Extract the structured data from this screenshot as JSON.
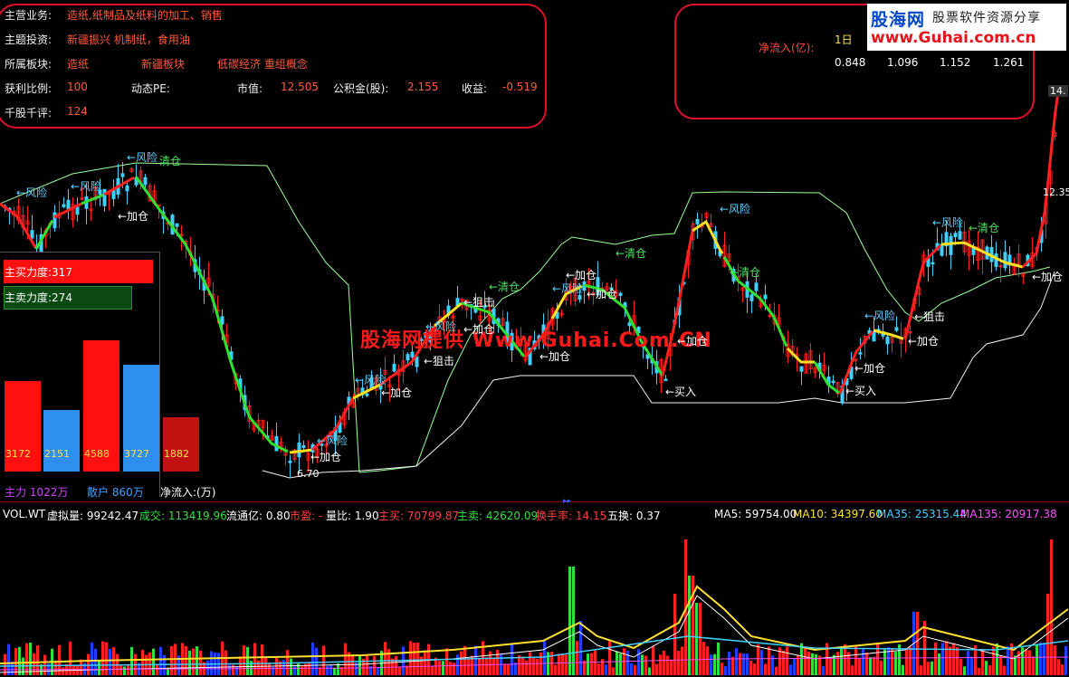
{
  "info": {
    "biz_label": "主营业务:",
    "biz_value": "造纸,纸制品及纸料的加工、销售",
    "theme_label": "主题投资:",
    "theme_value": "新疆振兴  机制纸，食用油",
    "sector_label": "所属板块:",
    "sector_1": "造纸",
    "sector_2": "新疆板块",
    "sector_3": "低碳经济 重组概念",
    "profit_label": "获利比例:",
    "profit_value": "100",
    "pe_label": "动态PE:",
    "mv_label": "市值:",
    "mv_value": "12.505",
    "fund_label": "公积金(股):",
    "fund_value": "2.155",
    "earn_label": "收益:",
    "earn_value": "-0.519",
    "review_label": "千股千评:",
    "review_value": "124"
  },
  "netflow": {
    "label": "净流入(亿):",
    "period": "1日",
    "values": [
      "0.848",
      "1.096",
      "1.152",
      "1.261"
    ]
  },
  "logo": {
    "brand": "股海网",
    "slogan": "股票软件资源分享",
    "url": "www.Guhai.com.cn"
  },
  "watermark": "股海网提供 Www.Guhai.Com.CN",
  "price_labels": {
    "top": "14.",
    "right": "12.35",
    "low": "6.70"
  },
  "force": {
    "buy_label": "主买力度:317",
    "sell_label": "主卖力度:274",
    "bars": [
      {
        "value": "3172",
        "color": "#ff1010",
        "level": 0.4
      },
      {
        "value": "2151",
        "color": "#2f8ff0",
        "level": 0.27
      },
      {
        "value": "4588",
        "color": "#ff1010",
        "level": 0.58
      },
      {
        "value": "3727",
        "color": "#2f8ff0",
        "level": 0.47
      },
      {
        "value": "1882",
        "color": "#c01010",
        "level": 0.24
      }
    ],
    "main_label": "主力 1022万",
    "retail_label": "散户 860万",
    "netin_label": "净流入:(万)"
  },
  "annotations": [
    {
      "text": "←风险",
      "color": "#5fd0ff"
    },
    {
      "text": "←风险",
      "color": "#5fd0ff"
    },
    {
      "text": "←风险",
      "color": "#5fd0ff"
    },
    {
      "text": "清仓",
      "color": "#4fe060"
    },
    {
      "text": "←加仓",
      "color": "#ffffff"
    },
    {
      "text": "←风险",
      "color": "#5fd0ff"
    },
    {
      "text": "←加仓",
      "color": "#ffffff"
    },
    {
      "text": "←风险",
      "color": "#5fd0ff"
    },
    {
      "text": "←加仓",
      "color": "#ffffff"
    },
    {
      "text": "←狙击",
      "color": "#ffffff"
    },
    {
      "text": "←风险",
      "color": "#5fd0ff"
    },
    {
      "text": "←狙击",
      "color": "#ffffff"
    },
    {
      "text": "←加仓",
      "color": "#ffffff"
    },
    {
      "text": "←清仓",
      "color": "#4fe060"
    },
    {
      "text": "←加仓",
      "color": "#ffffff"
    },
    {
      "text": "←风险",
      "color": "#5fd0ff"
    },
    {
      "text": "←加仓",
      "color": "#ffffff"
    },
    {
      "text": "←清仓",
      "color": "#4fe060"
    },
    {
      "text": "←加仓",
      "color": "#ffffff"
    },
    {
      "text": "←买入",
      "color": "#ffffff"
    },
    {
      "text": "←风险",
      "color": "#5fd0ff"
    },
    {
      "text": "←清仓",
      "color": "#4fe060"
    },
    {
      "text": "←加仓",
      "color": "#ffffff"
    },
    {
      "text": "←买入",
      "color": "#ffffff"
    },
    {
      "text": "←风险",
      "color": "#5fd0ff"
    },
    {
      "text": "←狙击",
      "color": "#ffffff"
    },
    {
      "text": "←加仓",
      "color": "#ffffff"
    },
    {
      "text": "←加仓",
      "color": "#ffffff"
    },
    {
      "text": "←风险",
      "color": "#5fd0ff"
    },
    {
      "text": "←清仓",
      "color": "#4fe060"
    },
    {
      "text": "←加仓",
      "color": "#ffffff"
    }
  ],
  "volume_bar": {
    "name": "VOL.WT",
    "virtual": "虚拟量: 99242.47",
    "turnover": "成交: 113419.96",
    "float": "流通亿: 0.80",
    "pe": "市盈: -",
    "ratio": "量比: 1.90",
    "buy": "主买: 70799.87",
    "sell": "主卖: 42620.09",
    "turn_rate": "换手率: 14.15",
    "five": "五换: 0.37",
    "ma5": "MA5: 59754.00",
    "ma10": "MA10: 34397.60",
    "ma35": "MA35: 25315.44",
    "ma135": "MA135: 20917.38"
  },
  "colors": {
    "up": "#ff2020",
    "down": "#3fd0ff",
    "frame": "#e0102a",
    "trend_green": "#30e030",
    "trend_red": "#ff2020",
    "trend_yellow": "#ffe020"
  }
}
